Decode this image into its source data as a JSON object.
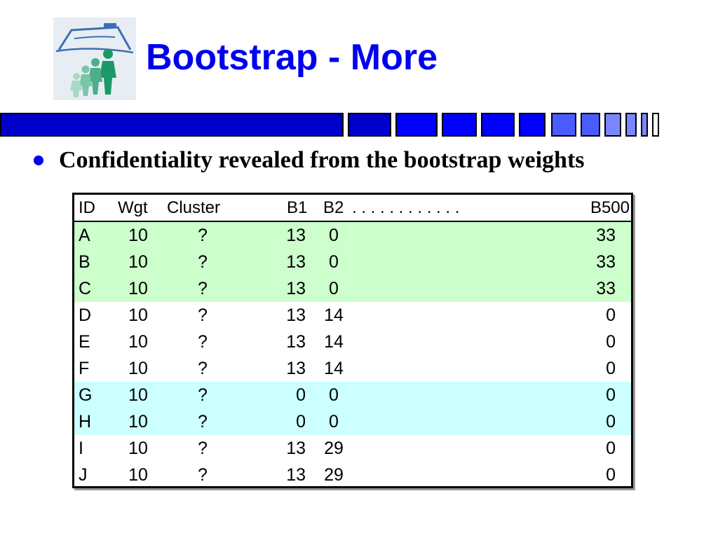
{
  "slide": {
    "title": "Bootstrap - More",
    "bullet": "Confidentiality revealed from the bootstrap weights",
    "colors": {
      "title": "#0000ee",
      "bar_dark": "#0000cc",
      "bar_mid": "#0000ff",
      "bar_light": "#4a5cff",
      "bar_pale": "#7a86ff",
      "row_green": "#ccffcc",
      "row_cyan": "#ccffff"
    },
    "logo_icon": "people-under-roof-icon"
  },
  "table": {
    "headers": {
      "id": "ID",
      "wgt": "Wgt",
      "cluster": "Cluster",
      "b1": "B1",
      "b2": "B2",
      "dots": ". . . . . . . . . . . .",
      "b500": "B500"
    },
    "rows": [
      {
        "id": "A",
        "wgt": "10",
        "cluster": "?",
        "b1": "13",
        "b2": "0",
        "b500": "33",
        "highlight": "green"
      },
      {
        "id": "B",
        "wgt": "10",
        "cluster": "?",
        "b1": "13",
        "b2": "0",
        "b500": "33",
        "highlight": "green"
      },
      {
        "id": "C",
        "wgt": "10",
        "cluster": "?",
        "b1": "13",
        "b2": "0",
        "b500": "33",
        "highlight": "green"
      },
      {
        "id": "D",
        "wgt": "10",
        "cluster": "?",
        "b1": "13",
        "b2": "14",
        "b500": "0",
        "highlight": "none"
      },
      {
        "id": "E",
        "wgt": "10",
        "cluster": "?",
        "b1": "13",
        "b2": "14",
        "b500": "0",
        "highlight": "none"
      },
      {
        "id": "F",
        "wgt": "10",
        "cluster": "?",
        "b1": "13",
        "b2": "14",
        "b500": "0",
        "highlight": "none"
      },
      {
        "id": "G",
        "wgt": "10",
        "cluster": "?",
        "b1": "0",
        "b2": "0",
        "b500": "0",
        "highlight": "cyan"
      },
      {
        "id": "H",
        "wgt": "10",
        "cluster": "?",
        "b1": "0",
        "b2": "0",
        "b500": "0",
        "highlight": "cyan"
      },
      {
        "id": "I",
        "wgt": "10",
        "cluster": "?",
        "b1": "13",
        "b2": "29",
        "b500": "0",
        "highlight": "none"
      },
      {
        "id": "J",
        "wgt": "10",
        "cluster": "?",
        "b1": "13",
        "b2": "29",
        "b500": "0",
        "highlight": "none"
      }
    ]
  }
}
